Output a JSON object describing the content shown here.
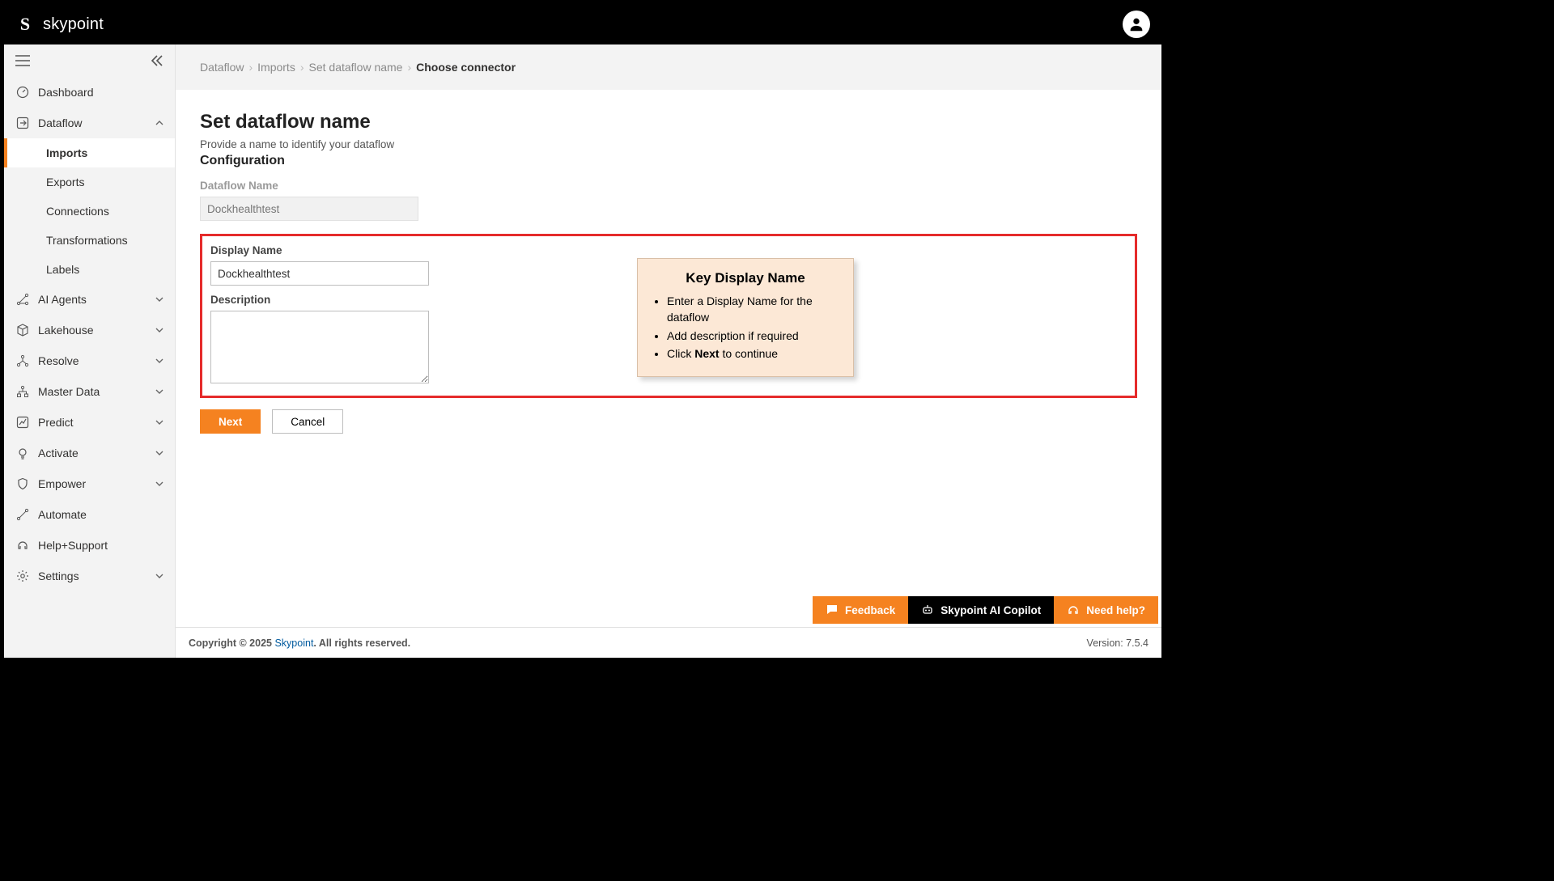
{
  "brand": {
    "name": "skypoint"
  },
  "sidebar": {
    "items": [
      {
        "label": "Dashboard"
      },
      {
        "label": "Dataflow"
      },
      {
        "label": "AI Agents"
      },
      {
        "label": "Lakehouse"
      },
      {
        "label": "Resolve"
      },
      {
        "label": "Master Data"
      },
      {
        "label": "Predict"
      },
      {
        "label": "Activate"
      },
      {
        "label": "Empower"
      },
      {
        "label": "Automate"
      },
      {
        "label": "Help+Support"
      },
      {
        "label": "Settings"
      }
    ],
    "dataflow_sub": [
      {
        "label": "Imports"
      },
      {
        "label": "Exports"
      },
      {
        "label": "Connections"
      },
      {
        "label": "Transformations"
      },
      {
        "label": "Labels"
      }
    ]
  },
  "breadcrumb": {
    "items": [
      "Dataflow",
      "Imports",
      "Set dataflow name"
    ],
    "current": "Choose connector"
  },
  "page": {
    "title": "Set dataflow name",
    "subtitle": "Provide a name to identify your dataflow",
    "section": "Configuration",
    "fields": {
      "dataflow_name_label": "Dataflow Name",
      "dataflow_name_value": "Dockhealthtest",
      "display_name_label": "Display Name",
      "display_name_value": "Dockhealthtest",
      "description_label": "Description",
      "description_value": ""
    },
    "buttons": {
      "next": "Next",
      "cancel": "Cancel"
    }
  },
  "callout": {
    "title": "Key Display Name",
    "lines": {
      "l1": "Enter a Display Name for the dataflow",
      "l2": "Add description if required",
      "l3a": "Click ",
      "l3b": "Next",
      "l3c": " to continue"
    }
  },
  "fabs": {
    "feedback": "Feedback",
    "copilot": "Skypoint AI Copilot",
    "help": "Need help?"
  },
  "footer": {
    "prefix": "Copyright © 2025 ",
    "link": "Skypoint",
    "suffix": ". All rights reserved.",
    "version": "Version: 7.5.4"
  }
}
